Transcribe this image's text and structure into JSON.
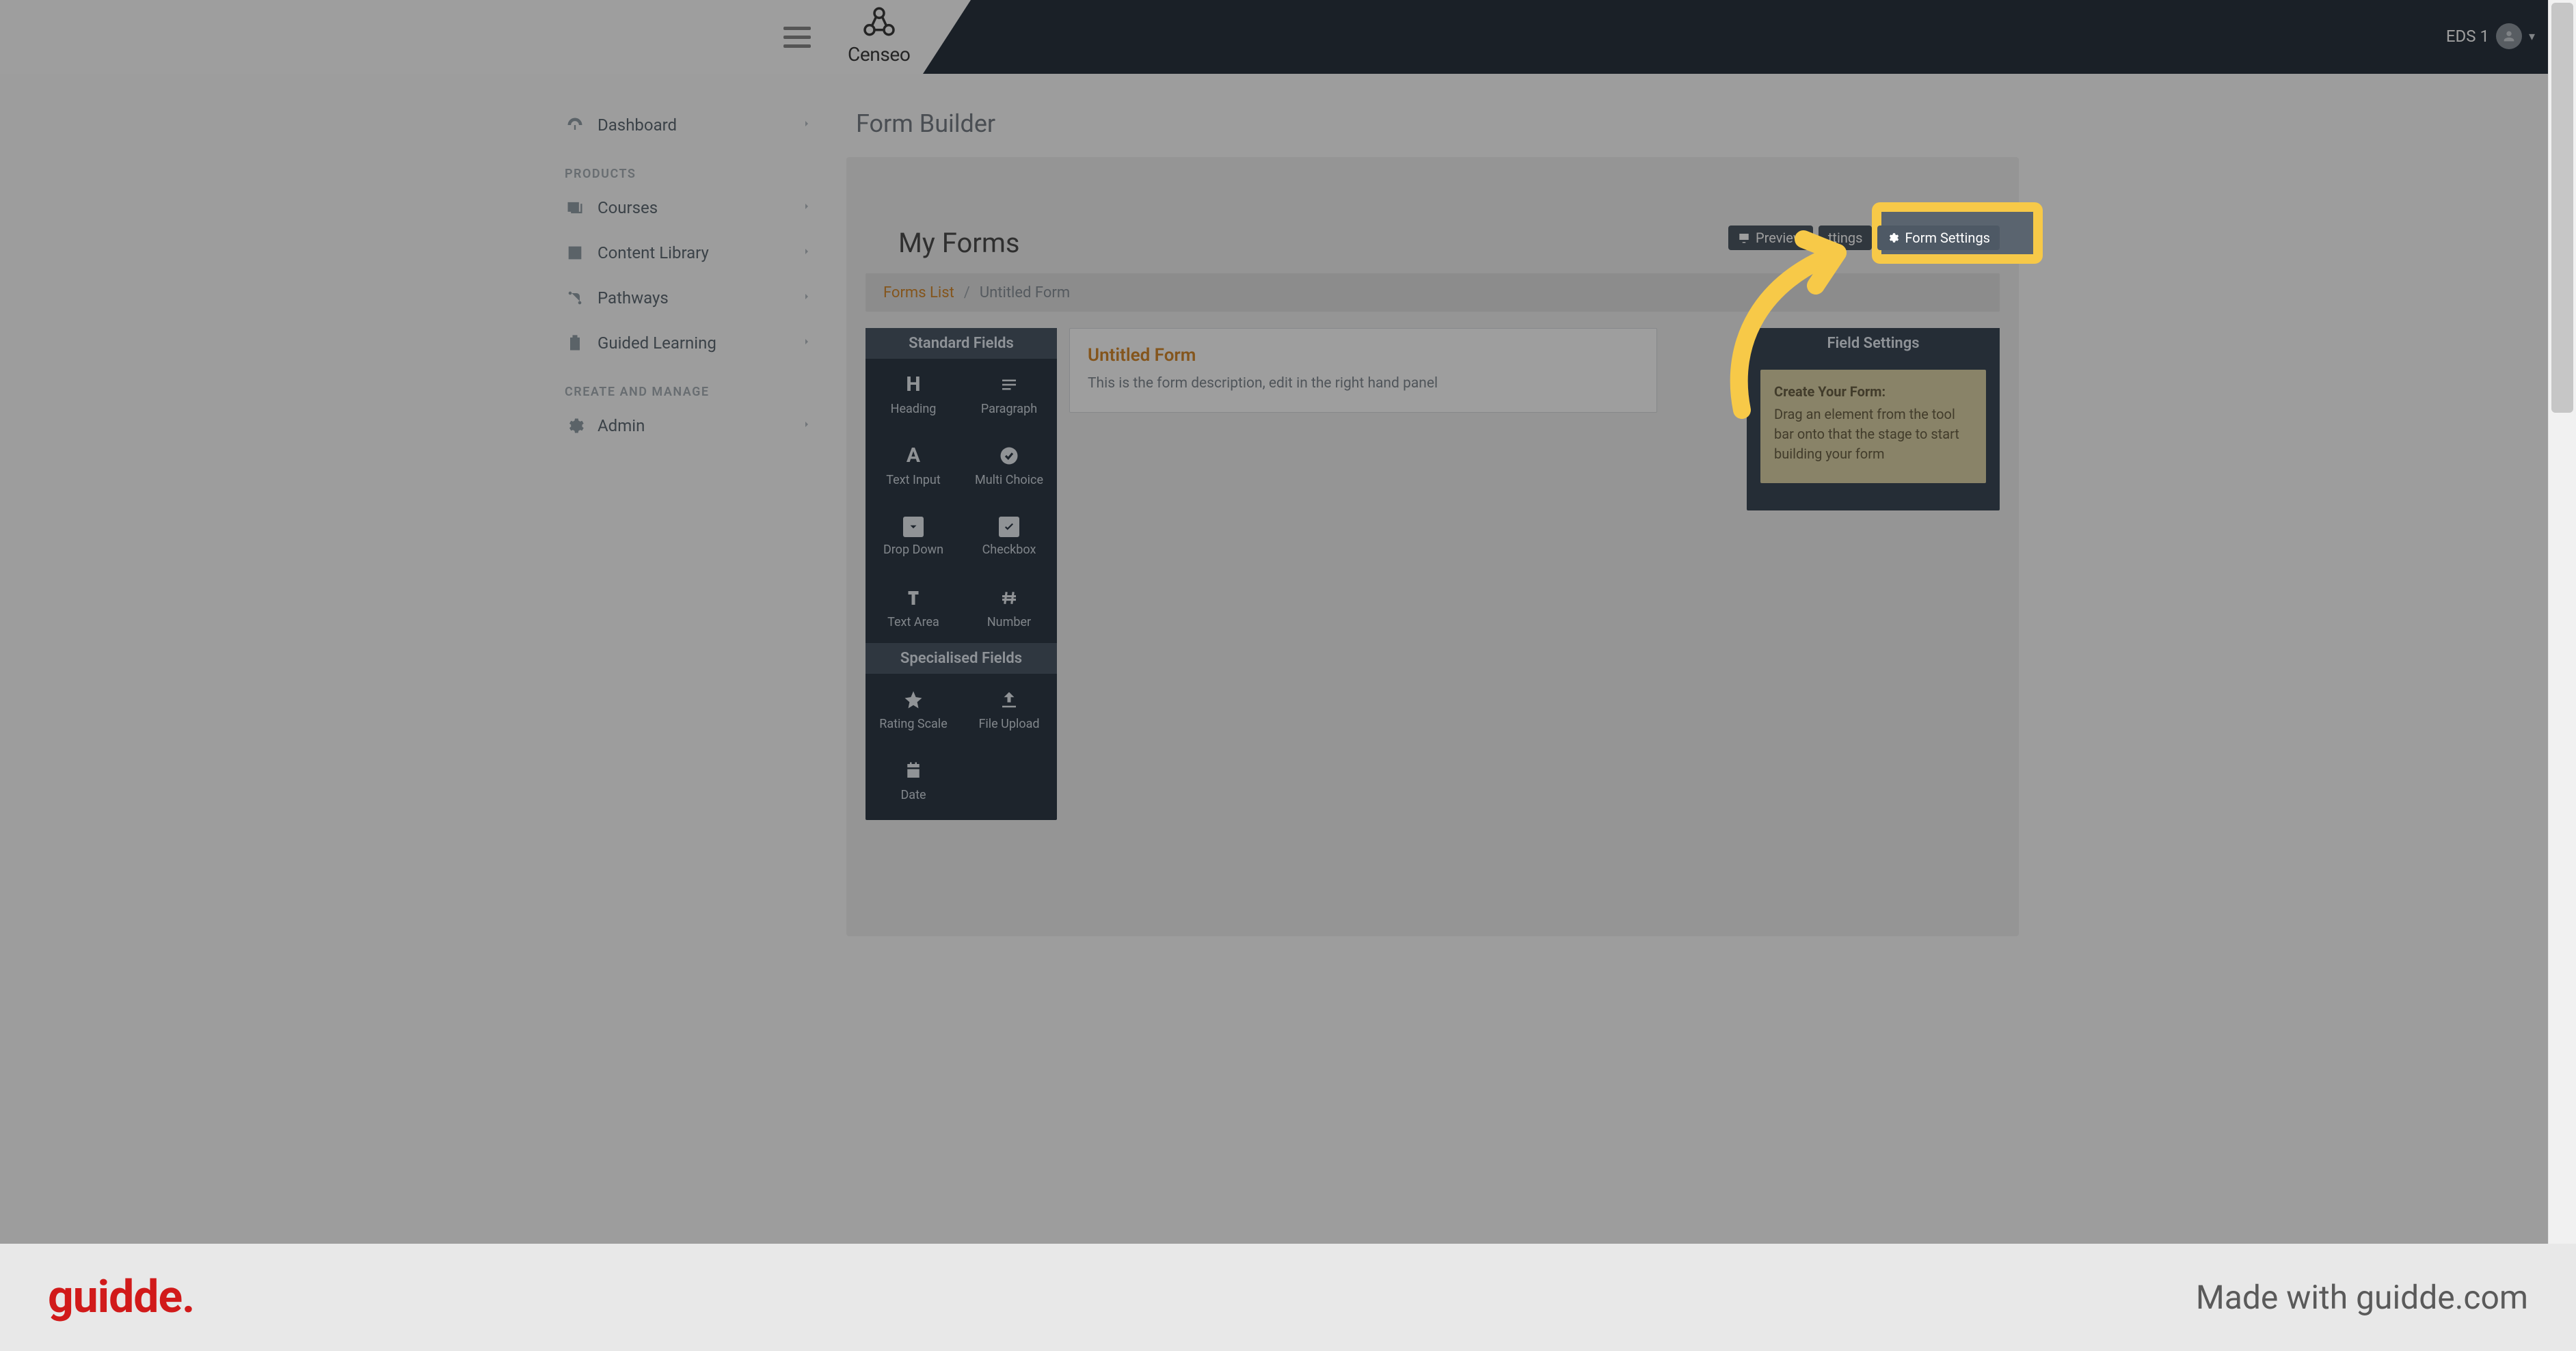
{
  "header": {
    "brand_name": "Censeo",
    "user_label": "EDS 1"
  },
  "sidebar": {
    "items": [
      {
        "label": "Dashboard"
      }
    ],
    "section_products": "PRODUCTS",
    "products": [
      {
        "label": "Courses"
      },
      {
        "label": "Content Library"
      },
      {
        "label": "Pathways"
      },
      {
        "label": "Guided Learning"
      }
    ],
    "section_manage": "CREATE AND MANAGE",
    "manage": [
      {
        "label": "Admin"
      }
    ]
  },
  "page": {
    "title": "Form Builder",
    "my_forms": "My Forms",
    "breadcrumb_link": "Forms List",
    "breadcrumb_sep": "/",
    "breadcrumb_current": "Untitled Form"
  },
  "actions": {
    "preview": "Preview",
    "settings_partial": "ttings",
    "form_settings": "Form Settings"
  },
  "palette": {
    "header_standard": "Standard Fields",
    "heading": "Heading",
    "paragraph": "Paragraph",
    "text_input": "Text Input",
    "multi_choice": "Multi Choice",
    "drop_down": "Drop Down",
    "checkbox": "Checkbox",
    "text_area": "Text Area",
    "number": "Number",
    "header_special": "Specialised Fields",
    "rating_scale": "Rating Scale",
    "file_upload": "File Upload",
    "date": "Date"
  },
  "stage": {
    "form_title": "Untitled Form",
    "form_desc": "This is the form description, edit in the right hand panel"
  },
  "field_settings": {
    "header": "Field Settings",
    "hint_title": "Create Your Form:",
    "hint_body": "Drag an element from the tool bar onto that the stage to start building your form"
  },
  "footer": {
    "logo": "guidde.",
    "made_with": "Made with guidde.com"
  }
}
